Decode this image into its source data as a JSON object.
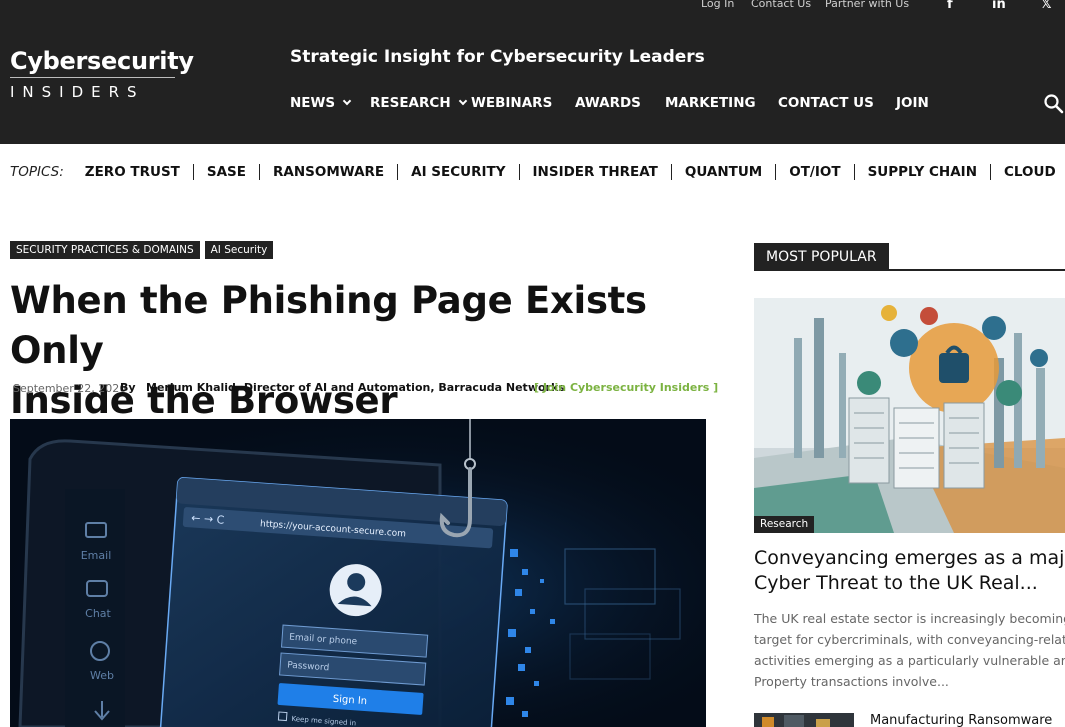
{
  "top_links": [
    "Log In",
    "Contact Us",
    "Partner with Us"
  ],
  "social_icons": [
    "facebook-icon",
    "linkedin-icon",
    "x-icon"
  ],
  "logo": {
    "line1": "Cybersecurity",
    "line2": "INSIDERS"
  },
  "tagline": "Strategic Insight for Cybersecurity Leaders",
  "nav": [
    {
      "label": "NEWS",
      "dropdown": true
    },
    {
      "label": "RESEARCH",
      "dropdown": true
    },
    {
      "label": "WEBINARS",
      "dropdown": false
    },
    {
      "label": "AWARDS",
      "dropdown": false
    },
    {
      "label": "MARKETING",
      "dropdown": false
    },
    {
      "label": "CONTACT US",
      "dropdown": false
    },
    {
      "label": "JOIN",
      "dropdown": false
    }
  ],
  "search_icon": "search-icon",
  "topics": {
    "label": "TOPICS:",
    "items": [
      "ZERO TRUST",
      "SASE",
      "RANSOMWARE",
      "AI SECURITY",
      "INSIDER THREAT",
      "QUANTUM",
      "OT/IOT",
      "SUPPLY CHAIN",
      "CLOUD"
    ]
  },
  "article": {
    "tags": [
      "SECURITY PRACTICES & DOMAINS",
      "AI Security"
    ],
    "title_line1": "When the Phishing Page Exists Only",
    "title_line2": "Inside the Browser",
    "date": "September 22, 2026",
    "by": "By",
    "author": "Merium Khalid, Director of AI and Automation, Barracuda Networks",
    "join_link": "[ Join Cybersecurity Insiders ]",
    "hero": {
      "url": "https://your-account-secure.com",
      "email_placeholder": "Email or phone",
      "password_placeholder": "Password",
      "signin": "Sign In",
      "keep_signed": "Keep me signed in",
      "app_icons": [
        "Email",
        "Chat",
        "Web"
      ]
    }
  },
  "sidebar": {
    "header": "MOST POPULAR",
    "badge": "Research",
    "title_line1": "Conveyancing emerges as a majo",
    "title_line2": "Cyber Threat to the UK Real...",
    "excerpt": [
      "The UK real estate sector is increasingly becoming a",
      "target for cybercriminals, with conveyancing-related",
      "activities emerging as a particularly vulnerable area.",
      "Property transactions involve..."
    ],
    "next_title": "Manufacturing Ransomware"
  },
  "colors": {
    "header_bg": "#222222",
    "accent_green": "#7cb342",
    "muted_text": "#666666"
  }
}
